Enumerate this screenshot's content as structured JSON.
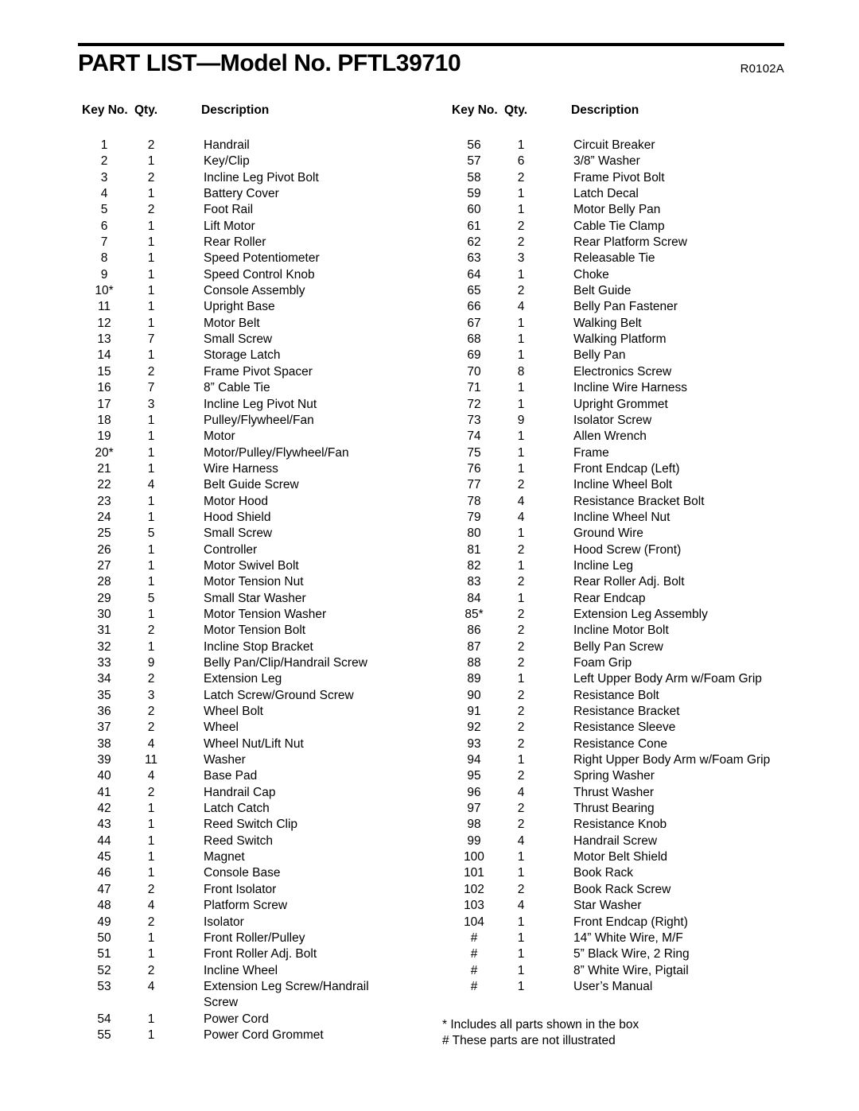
{
  "document": {
    "title": "PART LIST—Model No. PFTL39710",
    "revision": "R0102A"
  },
  "headers": {
    "key_no": "Key No.",
    "qty": "Qty.",
    "description": "Description"
  },
  "left_column": [
    {
      "key": "1",
      "qty": "2",
      "desc": "Handrail"
    },
    {
      "key": "2",
      "qty": "1",
      "desc": "Key/Clip"
    },
    {
      "key": "3",
      "qty": "2",
      "desc": "Incline Leg Pivot Bolt"
    },
    {
      "key": "4",
      "qty": "1",
      "desc": "Battery Cover"
    },
    {
      "key": "5",
      "qty": "2",
      "desc": "Foot Rail"
    },
    {
      "key": "6",
      "qty": "1",
      "desc": "Lift Motor"
    },
    {
      "key": "7",
      "qty": "1",
      "desc": "Rear Roller"
    },
    {
      "key": "8",
      "qty": "1",
      "desc": "Speed Potentiometer"
    },
    {
      "key": "9",
      "qty": "1",
      "desc": "Speed Control Knob"
    },
    {
      "key": "10*",
      "qty": "1",
      "desc": "Console Assembly"
    },
    {
      "key": "11",
      "qty": "1",
      "desc": "Upright Base"
    },
    {
      "key": "12",
      "qty": "1",
      "desc": "Motor Belt"
    },
    {
      "key": "13",
      "qty": "7",
      "desc": "Small Screw"
    },
    {
      "key": "14",
      "qty": "1",
      "desc": "Storage Latch"
    },
    {
      "key": "15",
      "qty": "2",
      "desc": "Frame Pivot Spacer"
    },
    {
      "key": "16",
      "qty": "7",
      "desc": "8” Cable Tie"
    },
    {
      "key": "17",
      "qty": "3",
      "desc": "Incline Leg Pivot Nut"
    },
    {
      "key": "18",
      "qty": "1",
      "desc": "Pulley/Flywheel/Fan"
    },
    {
      "key": "19",
      "qty": "1",
      "desc": "Motor"
    },
    {
      "key": "20*",
      "qty": "1",
      "desc": "Motor/Pulley/Flywheel/Fan"
    },
    {
      "key": "21",
      "qty": "1",
      "desc": "Wire Harness"
    },
    {
      "key": "22",
      "qty": "4",
      "desc": "Belt Guide Screw"
    },
    {
      "key": "23",
      "qty": "1",
      "desc": "Motor Hood"
    },
    {
      "key": "24",
      "qty": "1",
      "desc": "Hood Shield"
    },
    {
      "key": "25",
      "qty": "5",
      "desc": "Small Screw"
    },
    {
      "key": "26",
      "qty": "1",
      "desc": "Controller"
    },
    {
      "key": "27",
      "qty": "1",
      "desc": "Motor Swivel Bolt"
    },
    {
      "key": "28",
      "qty": "1",
      "desc": "Motor Tension Nut"
    },
    {
      "key": "29",
      "qty": "5",
      "desc": "Small Star Washer"
    },
    {
      "key": "30",
      "qty": "1",
      "desc": "Motor Tension Washer"
    },
    {
      "key": "31",
      "qty": "2",
      "desc": "Motor Tension Bolt"
    },
    {
      "key": "32",
      "qty": "1",
      "desc": "Incline Stop Bracket"
    },
    {
      "key": "33",
      "qty": "9",
      "desc": "Belly Pan/Clip/Handrail Screw"
    },
    {
      "key": "34",
      "qty": "2",
      "desc": "Extension Leg"
    },
    {
      "key": "35",
      "qty": "3",
      "desc": "Latch Screw/Ground Screw"
    },
    {
      "key": "36",
      "qty": "2",
      "desc": "Wheel Bolt"
    },
    {
      "key": "37",
      "qty": "2",
      "desc": "Wheel"
    },
    {
      "key": "38",
      "qty": "4",
      "desc": "Wheel Nut/Lift Nut"
    },
    {
      "key": "39",
      "qty": "11",
      "desc": "Washer"
    },
    {
      "key": "40",
      "qty": "4",
      "desc": "Base Pad"
    },
    {
      "key": "41",
      "qty": "2",
      "desc": "Handrail Cap"
    },
    {
      "key": "42",
      "qty": "1",
      "desc": "Latch Catch"
    },
    {
      "key": "43",
      "qty": "1",
      "desc": "Reed Switch Clip"
    },
    {
      "key": "44",
      "qty": "1",
      "desc": "Reed Switch"
    },
    {
      "key": "45",
      "qty": "1",
      "desc": "Magnet"
    },
    {
      "key": "46",
      "qty": "1",
      "desc": "Console Base"
    },
    {
      "key": "47",
      "qty": "2",
      "desc": "Front Isolator"
    },
    {
      "key": "48",
      "qty": "4",
      "desc": "Platform Screw"
    },
    {
      "key": "49",
      "qty": "2",
      "desc": "Isolator"
    },
    {
      "key": "50",
      "qty": "1",
      "desc": "Front Roller/Pulley"
    },
    {
      "key": "51",
      "qty": "1",
      "desc": "Front Roller Adj. Bolt"
    },
    {
      "key": "52",
      "qty": "2",
      "desc": "Incline Wheel"
    },
    {
      "key": "53",
      "qty": "4",
      "desc": "Extension Leg Screw/Handrail"
    },
    {
      "key": "",
      "qty": "",
      "desc": "Screw",
      "continuation": true
    },
    {
      "key": "54",
      "qty": "1",
      "desc": "Power Cord"
    },
    {
      "key": "55",
      "qty": "1",
      "desc": "Power Cord Grommet"
    }
  ],
  "right_column": [
    {
      "key": "56",
      "qty": "1",
      "desc": "Circuit Breaker"
    },
    {
      "key": "57",
      "qty": "6",
      "desc": "3/8” Washer"
    },
    {
      "key": "58",
      "qty": "2",
      "desc": "Frame Pivot Bolt"
    },
    {
      "key": "59",
      "qty": "1",
      "desc": "Latch Decal"
    },
    {
      "key": "60",
      "qty": "1",
      "desc": "Motor Belly Pan"
    },
    {
      "key": "61",
      "qty": "2",
      "desc": "Cable Tie Clamp"
    },
    {
      "key": "62",
      "qty": "2",
      "desc": "Rear Platform Screw"
    },
    {
      "key": "63",
      "qty": "3",
      "desc": "Releasable Tie"
    },
    {
      "key": "64",
      "qty": "1",
      "desc": "Choke"
    },
    {
      "key": "65",
      "qty": "2",
      "desc": "Belt Guide"
    },
    {
      "key": "66",
      "qty": "4",
      "desc": "Belly Pan Fastener"
    },
    {
      "key": "67",
      "qty": "1",
      "desc": "Walking Belt"
    },
    {
      "key": "68",
      "qty": "1",
      "desc": "Walking Platform"
    },
    {
      "key": "69",
      "qty": "1",
      "desc": "Belly Pan"
    },
    {
      "key": "70",
      "qty": "8",
      "desc": "Electronics Screw"
    },
    {
      "key": "71",
      "qty": "1",
      "desc": "Incline Wire Harness"
    },
    {
      "key": "72",
      "qty": "1",
      "desc": "Upright Grommet"
    },
    {
      "key": "73",
      "qty": "9",
      "desc": "Isolator Screw"
    },
    {
      "key": "74",
      "qty": "1",
      "desc": "Allen Wrench"
    },
    {
      "key": "75",
      "qty": "1",
      "desc": "Frame"
    },
    {
      "key": "76",
      "qty": "1",
      "desc": "Front Endcap (Left)"
    },
    {
      "key": "77",
      "qty": "2",
      "desc": "Incline Wheel Bolt"
    },
    {
      "key": "78",
      "qty": "4",
      "desc": "Resistance Bracket Bolt"
    },
    {
      "key": "79",
      "qty": "4",
      "desc": "Incline Wheel Nut"
    },
    {
      "key": "80",
      "qty": "1",
      "desc": "Ground Wire"
    },
    {
      "key": "81",
      "qty": "2",
      "desc": "Hood Screw (Front)"
    },
    {
      "key": "82",
      "qty": "1",
      "desc": "Incline Leg"
    },
    {
      "key": "83",
      "qty": "2",
      "desc": "Rear Roller Adj. Bolt"
    },
    {
      "key": "84",
      "qty": "1",
      "desc": "Rear Endcap"
    },
    {
      "key": "85*",
      "qty": "2",
      "desc": "Extension Leg Assembly"
    },
    {
      "key": "86",
      "qty": "2",
      "desc": "Incline Motor Bolt"
    },
    {
      "key": "87",
      "qty": "2",
      "desc": "Belly Pan Screw"
    },
    {
      "key": "88",
      "qty": "2",
      "desc": "Foam Grip"
    },
    {
      "key": "89",
      "qty": "1",
      "desc": "Left Upper Body Arm w/Foam Grip"
    },
    {
      "key": "90",
      "qty": "2",
      "desc": "Resistance Bolt"
    },
    {
      "key": "91",
      "qty": "2",
      "desc": "Resistance Bracket"
    },
    {
      "key": "92",
      "qty": "2",
      "desc": "Resistance Sleeve"
    },
    {
      "key": "93",
      "qty": "2",
      "desc": "Resistance Cone"
    },
    {
      "key": "94",
      "qty": "1",
      "desc": "Right Upper Body Arm w/Foam Grip"
    },
    {
      "key": "95",
      "qty": "2",
      "desc": "Spring Washer"
    },
    {
      "key": "96",
      "qty": "4",
      "desc": "Thrust Washer"
    },
    {
      "key": "97",
      "qty": "2",
      "desc": "Thrust Bearing"
    },
    {
      "key": "98",
      "qty": "2",
      "desc": "Resistance Knob"
    },
    {
      "key": "99",
      "qty": "4",
      "desc": "Handrail Screw"
    },
    {
      "key": "100",
      "qty": "1",
      "desc": "Motor Belt Shield"
    },
    {
      "key": "101",
      "qty": "1",
      "desc": "Book Rack"
    },
    {
      "key": "102",
      "qty": "2",
      "desc": "Book Rack Screw"
    },
    {
      "key": "103",
      "qty": "4",
      "desc": "Star Washer"
    },
    {
      "key": "104",
      "qty": "1",
      "desc": "Front Endcap (Right)"
    },
    {
      "key": "#",
      "qty": "1",
      "desc": "14” White Wire, M/F"
    },
    {
      "key": "#",
      "qty": "1",
      "desc": "5” Black Wire, 2 Ring"
    },
    {
      "key": "#",
      "qty": "1",
      "desc": "8” White Wire, Pigtail"
    },
    {
      "key": "#",
      "qty": "1",
      "desc": "User’s Manual"
    }
  ],
  "footnotes": [
    "* Includes all parts shown in the box",
    "# These parts are not illustrated"
  ]
}
